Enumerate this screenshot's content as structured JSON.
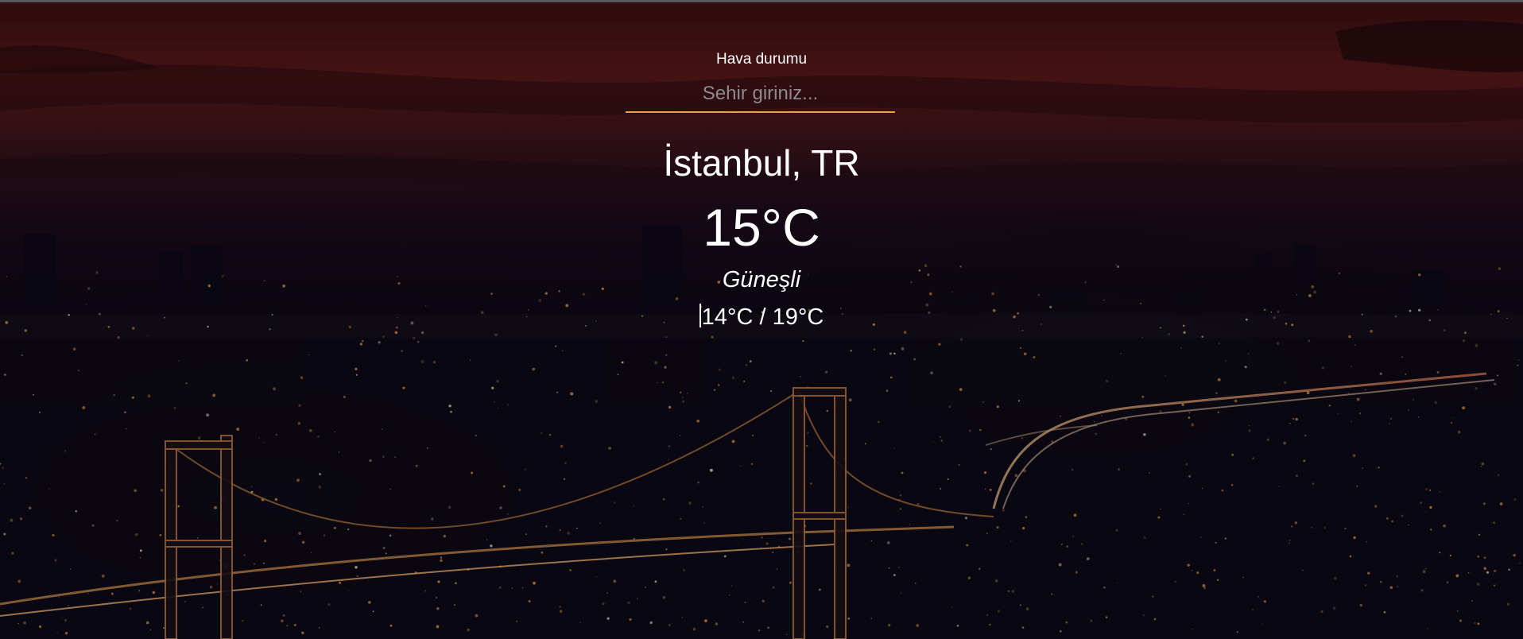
{
  "app": {
    "title": "Hava durumu"
  },
  "search": {
    "placeholder": "Sehir giriniz...",
    "value": "",
    "accent_color": "#e8a33c"
  },
  "weather": {
    "location": "İstanbul, TR",
    "temperature": "15°C",
    "description": "Güneşli",
    "hi_low": "14°C / 19°C"
  },
  "background": {
    "description_icon": "city-night-bridge-image",
    "sky_color": "#4a1414",
    "night_color": "#0a0612",
    "lights_color": "#f2a34a"
  }
}
